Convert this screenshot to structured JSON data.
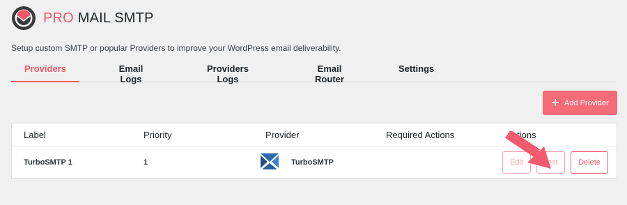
{
  "brand": {
    "pro": "PRO",
    "rest": " MAIL SMTP"
  },
  "subtitle": "Setup custom SMTP or popular Providers to improve your WordPress email deliverability.",
  "tabs": [
    {
      "label": "Providers",
      "active": true
    },
    {
      "label": "Email Logs"
    },
    {
      "label": "Providers Logs"
    },
    {
      "label": "Email Router"
    },
    {
      "label": "Settings"
    }
  ],
  "add_button": {
    "label": "Add Provider",
    "icon": "plus-icon"
  },
  "table": {
    "columns": [
      "Label",
      "Priority",
      "Provider",
      "Required Actions",
      "Actions"
    ],
    "rows": [
      {
        "label": "TurboSMTP 1",
        "priority": "1",
        "provider": "TurboSMTP",
        "required_actions": "",
        "actions": {
          "edit": "Edit",
          "test": "Test",
          "delete": "Delete"
        }
      }
    ]
  },
  "colors": {
    "accent": "#f05867",
    "button": "#f56b78",
    "arrow": "#f25b6e"
  }
}
